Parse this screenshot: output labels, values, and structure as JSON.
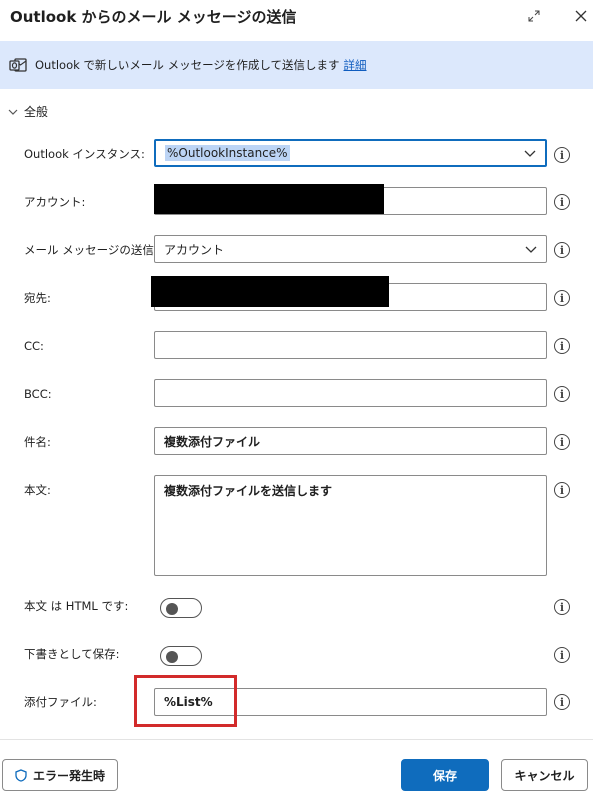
{
  "dialog": {
    "title": "Outlook からのメール メッセージの送信",
    "banner_text": "Outlook で新しいメール メッセージを作成して送信します",
    "banner_link": "詳細",
    "section": "全般"
  },
  "fields": {
    "instance": {
      "label": "Outlook インスタンス:",
      "value": "%OutlookInstance%"
    },
    "account": {
      "label": "アカウント:",
      "value": ""
    },
    "send_from": {
      "label": "メール メッセージの送信元:",
      "value": "アカウント"
    },
    "to": {
      "label": "宛先:",
      "value": ""
    },
    "cc": {
      "label": "CC:",
      "value": ""
    },
    "bcc": {
      "label": "BCC:",
      "value": ""
    },
    "subject": {
      "label": "件名:",
      "value": "複数添付ファイル"
    },
    "body": {
      "label": "本文:",
      "value": "複数添付ファイルを送信します"
    },
    "html": {
      "label": "本文 は HTML です:",
      "on": false
    },
    "draft": {
      "label": "下書きとして保存:",
      "on": false
    },
    "attachment": {
      "label": "添付ファイル:",
      "value": "%List%"
    }
  },
  "footer": {
    "error_button": "エラー発生時",
    "save_button": "保存",
    "cancel_button": "キャンセル"
  },
  "colors": {
    "accent": "#0f6cbd",
    "banner_bg": "#dce8fc",
    "highlight": "#d22a2a",
    "selection": "#bcd4f5"
  }
}
